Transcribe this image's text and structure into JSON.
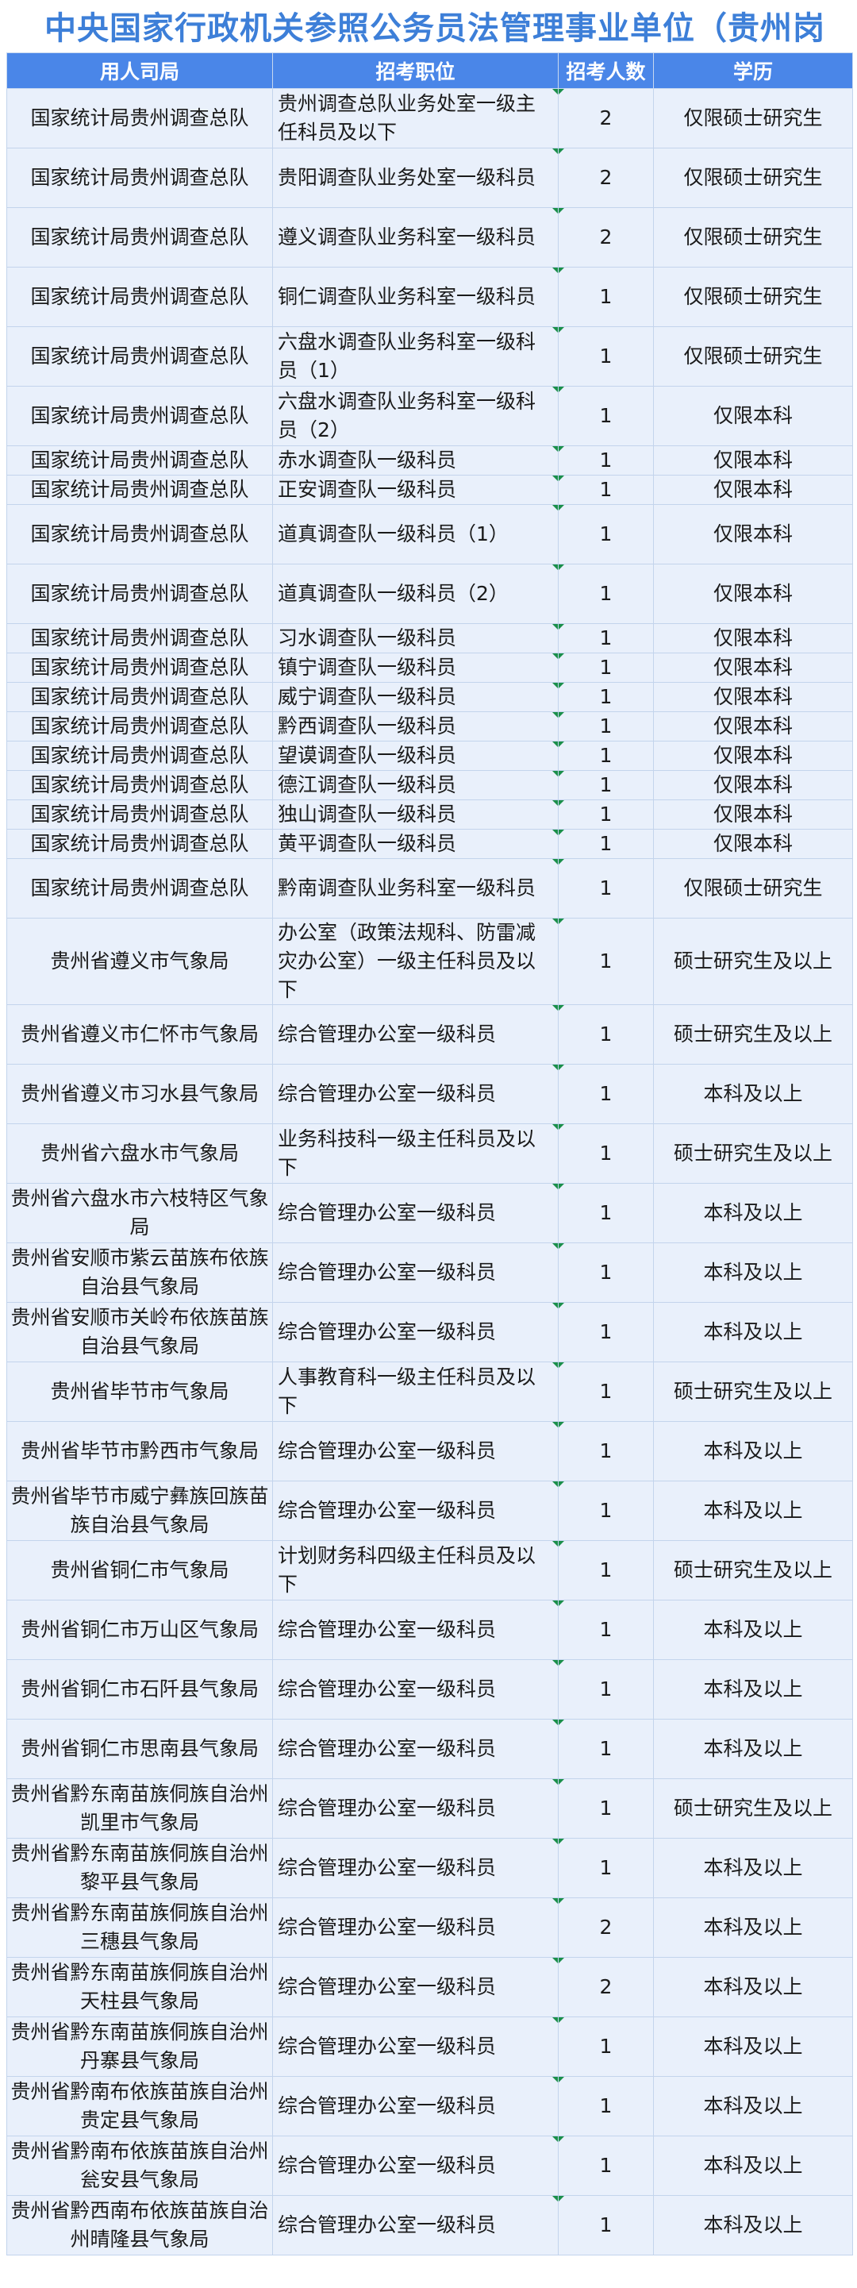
{
  "title": "中央国家行政机关参照公务员法管理事业单位（贵州岗",
  "columns": [
    "用人司局",
    "招考职位",
    "招考人数",
    "学历"
  ],
  "rows": [
    {
      "org": "国家统计局贵州调查总队",
      "position": "贵州调查总队业务处室一级主任科员及以下",
      "count": "2",
      "edu": "仅限硕士研究生"
    },
    {
      "org": "国家统计局贵州调查总队",
      "position": "贵阳调查队业务处室一级科员",
      "count": "2",
      "edu": "仅限硕士研究生"
    },
    {
      "org": "国家统计局贵州调查总队",
      "position": "遵义调查队业务科室一级科员",
      "count": "2",
      "edu": "仅限硕士研究生"
    },
    {
      "org": "国家统计局贵州调查总队",
      "position": "铜仁调查队业务科室一级科员",
      "count": "1",
      "edu": "仅限硕士研究生"
    },
    {
      "org": "国家统计局贵州调查总队",
      "position": "六盘水调查队业务科室一级科员（1）",
      "count": "1",
      "edu": "仅限硕士研究生"
    },
    {
      "org": "国家统计局贵州调查总队",
      "position": "六盘水调查队业务科室一级科员（2）",
      "count": "1",
      "edu": "仅限本科"
    },
    {
      "org": "国家统计局贵州调查总队",
      "position": "赤水调查队一级科员",
      "count": "1",
      "edu": "仅限本科"
    },
    {
      "org": "国家统计局贵州调查总队",
      "position": "正安调查队一级科员",
      "count": "1",
      "edu": "仅限本科"
    },
    {
      "org": "国家统计局贵州调查总队",
      "position": "道真调查队一级科员（1）",
      "count": "1",
      "edu": "仅限本科"
    },
    {
      "org": "国家统计局贵州调查总队",
      "position": "道真调查队一级科员（2）",
      "count": "1",
      "edu": "仅限本科"
    },
    {
      "org": "国家统计局贵州调查总队",
      "position": "习水调查队一级科员",
      "count": "1",
      "edu": "仅限本科"
    },
    {
      "org": "国家统计局贵州调查总队",
      "position": "镇宁调查队一级科员",
      "count": "1",
      "edu": "仅限本科"
    },
    {
      "org": "国家统计局贵州调查总队",
      "position": "威宁调查队一级科员",
      "count": "1",
      "edu": "仅限本科"
    },
    {
      "org": "国家统计局贵州调查总队",
      "position": "黔西调查队一级科员",
      "count": "1",
      "edu": "仅限本科"
    },
    {
      "org": "国家统计局贵州调查总队",
      "position": "望谟调查队一级科员",
      "count": "1",
      "edu": "仅限本科"
    },
    {
      "org": "国家统计局贵州调查总队",
      "position": "德江调查队一级科员",
      "count": "1",
      "edu": "仅限本科"
    },
    {
      "org": "国家统计局贵州调查总队",
      "position": "独山调查队一级科员",
      "count": "1",
      "edu": "仅限本科"
    },
    {
      "org": "国家统计局贵州调查总队",
      "position": "黄平调查队一级科员",
      "count": "1",
      "edu": "仅限本科"
    },
    {
      "org": "国家统计局贵州调查总队",
      "position": "黔南调查队业务科室一级科员",
      "count": "1",
      "edu": "仅限硕士研究生"
    },
    {
      "org": "贵州省遵义市气象局",
      "position": "办公室（政策法规科、防雷减灾办公室）一级主任科员及以下",
      "count": "1",
      "edu": "硕士研究生及以上"
    },
    {
      "org": "贵州省遵义市仁怀市气象局",
      "position": "综合管理办公室一级科员",
      "count": "1",
      "edu": "硕士研究生及以上"
    },
    {
      "org": "贵州省遵义市习水县气象局",
      "position": "综合管理办公室一级科员",
      "count": "1",
      "edu": "本科及以上"
    },
    {
      "org": "贵州省六盘水市气象局",
      "position": "业务科技科一级主任科员及以下",
      "count": "1",
      "edu": "硕士研究生及以上"
    },
    {
      "org": "贵州省六盘水市六枝特区气象局",
      "position": "综合管理办公室一级科员",
      "count": "1",
      "edu": "本科及以上"
    },
    {
      "org": "贵州省安顺市紫云苗族布依族自治县气象局",
      "position": "综合管理办公室一级科员",
      "count": "1",
      "edu": "本科及以上"
    },
    {
      "org": "贵州省安顺市关岭布依族苗族自治县气象局",
      "position": "综合管理办公室一级科员",
      "count": "1",
      "edu": "本科及以上"
    },
    {
      "org": "贵州省毕节市气象局",
      "position": "人事教育科一级主任科员及以下",
      "count": "1",
      "edu": "硕士研究生及以上"
    },
    {
      "org": "贵州省毕节市黔西市气象局",
      "position": "综合管理办公室一级科员",
      "count": "1",
      "edu": "本科及以上"
    },
    {
      "org": "贵州省毕节市威宁彝族回族苗族自治县气象局",
      "position": "综合管理办公室一级科员",
      "count": "1",
      "edu": "本科及以上"
    },
    {
      "org": "贵州省铜仁市气象局",
      "position": "计划财务科四级主任科员及以下",
      "count": "1",
      "edu": "硕士研究生及以上"
    },
    {
      "org": "贵州省铜仁市万山区气象局",
      "position": "综合管理办公室一级科员",
      "count": "1",
      "edu": "本科及以上"
    },
    {
      "org": "贵州省铜仁市石阡县气象局",
      "position": "综合管理办公室一级科员",
      "count": "1",
      "edu": "本科及以上"
    },
    {
      "org": "贵州省铜仁市思南县气象局",
      "position": "综合管理办公室一级科员",
      "count": "1",
      "edu": "本科及以上"
    },
    {
      "org": "贵州省黔东南苗族侗族自治州凯里市气象局",
      "position": "综合管理办公室一级科员",
      "count": "1",
      "edu": "硕士研究生及以上"
    },
    {
      "org": "贵州省黔东南苗族侗族自治州黎平县气象局",
      "position": "综合管理办公室一级科员",
      "count": "1",
      "edu": "本科及以上"
    },
    {
      "org": "贵州省黔东南苗族侗族自治州三穗县气象局",
      "position": "综合管理办公室一级科员",
      "count": "2",
      "edu": "本科及以上"
    },
    {
      "org": "贵州省黔东南苗族侗族自治州天柱县气象局",
      "position": "综合管理办公室一级科员",
      "count": "2",
      "edu": "本科及以上"
    },
    {
      "org": "贵州省黔东南苗族侗族自治州丹寨县气象局",
      "position": "综合管理办公室一级科员",
      "count": "1",
      "edu": "本科及以上"
    },
    {
      "org": "贵州省黔南布依族苗族自治州贵定县气象局",
      "position": "综合管理办公室一级科员",
      "count": "1",
      "edu": "本科及以上"
    },
    {
      "org": "贵州省黔南布依族苗族自治州瓮安县气象局",
      "position": "综合管理办公室一级科员",
      "count": "1",
      "edu": "本科及以上"
    },
    {
      "org": "贵州省黔西南布依族苗族自治州晴隆县气象局",
      "position": "综合管理办公室一级科员",
      "count": "1",
      "edu": "本科及以上"
    }
  ]
}
